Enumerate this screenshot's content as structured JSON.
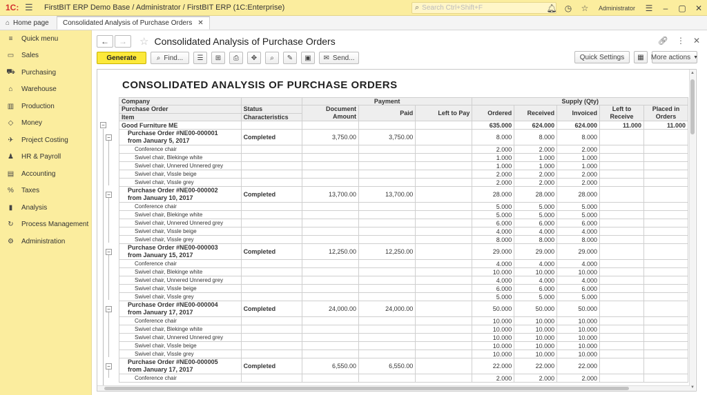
{
  "titlebar": {
    "logo": "1C:",
    "title": "FirstBIT ERP Demo Base / Administrator / FirstBIT ERP  (1C:Enterprise)",
    "search_placeholder": "Search Ctrl+Shift+F",
    "user": "Administrator"
  },
  "tabs": {
    "home": "Home page",
    "active": "Consolidated Analysis of Purchase Orders"
  },
  "sidebar": {
    "items": [
      {
        "label": "Quick menu",
        "icon": "≡"
      },
      {
        "label": "Sales",
        "icon": "▭"
      },
      {
        "label": "Purchasing",
        "icon": "⛟"
      },
      {
        "label": "Warehouse",
        "icon": "⌂"
      },
      {
        "label": "Production",
        "icon": "▥"
      },
      {
        "label": "Money",
        "icon": "◇"
      },
      {
        "label": "Project Costing",
        "icon": "✈"
      },
      {
        "label": "HR & Payroll",
        "icon": "♟"
      },
      {
        "label": "Accounting",
        "icon": "▤"
      },
      {
        "label": "Taxes",
        "icon": "%"
      },
      {
        "label": "Analysis",
        "icon": "▮"
      },
      {
        "label": "Process Management",
        "icon": "↻"
      },
      {
        "label": "Administration",
        "icon": "⚙"
      }
    ]
  },
  "page": {
    "title": "Consolidated Analysis of Purchase Orders"
  },
  "toolbar": {
    "generate": "Generate",
    "find": "Find...",
    "send": "Send...",
    "quick_settings": "Quick Settings",
    "more_actions": "More actions"
  },
  "report": {
    "title": "CONSOLIDATED ANALYSIS OF PURCHASE ORDERS",
    "headers": {
      "company": "Company",
      "purchase_order": "Purchase Order",
      "item": "Item",
      "status": "Status",
      "characteristics": "Characteristics",
      "payment": "Payment",
      "document_amount": "Document Amount",
      "paid": "Paid",
      "left_to_pay": "Left to Pay",
      "supply": "Supply (Qty)",
      "ordered": "Ordered",
      "received": "Received",
      "invoiced": "Invoiced",
      "left_to_receive": "Left to Receive",
      "placed_in_orders": "Placed in Orders"
    },
    "org": {
      "name": "Good Furniture ME",
      "ordered": "635.000",
      "received": "624.000",
      "invoiced": "624.000",
      "left_to_receive": "11.000",
      "placed": "11.000"
    },
    "orders": [
      {
        "line1": "Purchase Order #NE00-000001",
        "line2": "from January 5, 2017",
        "status": "Completed",
        "amount": "3,750.00",
        "paid": "3,750.00",
        "ordered": "8.000",
        "received": "8.000",
        "invoiced": "8.000",
        "items": [
          [
            "Conference chair",
            "2.000",
            "2.000",
            "2.000"
          ],
          [
            "Swivel chair, Blekinge white",
            "1.000",
            "1.000",
            "1.000"
          ],
          [
            "Swivel chair, Unnered Unnered grey",
            "1.000",
            "1.000",
            "1.000"
          ],
          [
            "Swivel chair, Vissle beige",
            "2.000",
            "2.000",
            "2.000"
          ],
          [
            "Swivel chair, Vissle grey",
            "2.000",
            "2.000",
            "2.000"
          ]
        ]
      },
      {
        "line1": "Purchase Order #NE00-000002",
        "line2": "from January 10, 2017",
        "status": "Completed",
        "amount": "13,700.00",
        "paid": "13,700.00",
        "ordered": "28.000",
        "received": "28.000",
        "invoiced": "28.000",
        "items": [
          [
            "Conference chair",
            "5.000",
            "5.000",
            "5.000"
          ],
          [
            "Swivel chair, Blekinge white",
            "5.000",
            "5.000",
            "5.000"
          ],
          [
            "Swivel chair, Unnered Unnered grey",
            "6.000",
            "6.000",
            "6.000"
          ],
          [
            "Swivel chair, Vissle beige",
            "4.000",
            "4.000",
            "4.000"
          ],
          [
            "Swivel chair, Vissle grey",
            "8.000",
            "8.000",
            "8.000"
          ]
        ]
      },
      {
        "line1": "Purchase Order #NE00-000003",
        "line2": "from January 15, 2017",
        "status": "Completed",
        "amount": "12,250.00",
        "paid": "12,250.00",
        "ordered": "29.000",
        "received": "29.000",
        "invoiced": "29.000",
        "items": [
          [
            "Conference chair",
            "4.000",
            "4.000",
            "4.000"
          ],
          [
            "Swivel chair, Blekinge white",
            "10.000",
            "10.000",
            "10.000"
          ],
          [
            "Swivel chair, Unnered Unnered grey",
            "4.000",
            "4.000",
            "4.000"
          ],
          [
            "Swivel chair, Vissle beige",
            "6.000",
            "6.000",
            "6.000"
          ],
          [
            "Swivel chair, Vissle grey",
            "5.000",
            "5.000",
            "5.000"
          ]
        ]
      },
      {
        "line1": "Purchase Order #NE00-000004",
        "line2": "from January 17, 2017",
        "status": "Completed",
        "amount": "24,000.00",
        "paid": "24,000.00",
        "ordered": "50.000",
        "received": "50.000",
        "invoiced": "50.000",
        "items": [
          [
            "Conference chair",
            "10.000",
            "10.000",
            "10.000"
          ],
          [
            "Swivel chair, Blekinge white",
            "10.000",
            "10.000",
            "10.000"
          ],
          [
            "Swivel chair, Unnered Unnered grey",
            "10.000",
            "10.000",
            "10.000"
          ],
          [
            "Swivel chair, Vissle beige",
            "10.000",
            "10.000",
            "10.000"
          ],
          [
            "Swivel chair, Vissle grey",
            "10.000",
            "10.000",
            "10.000"
          ]
        ]
      },
      {
        "line1": "Purchase Order #NE00-000005",
        "line2": "from January 17, 2017",
        "status": "Completed",
        "amount": "6,550.00",
        "paid": "6,550.00",
        "ordered": "22.000",
        "received": "22.000",
        "invoiced": "22.000",
        "items": [
          [
            "Conference chair",
            "2.000",
            "2.000",
            "2.000"
          ]
        ]
      }
    ]
  }
}
